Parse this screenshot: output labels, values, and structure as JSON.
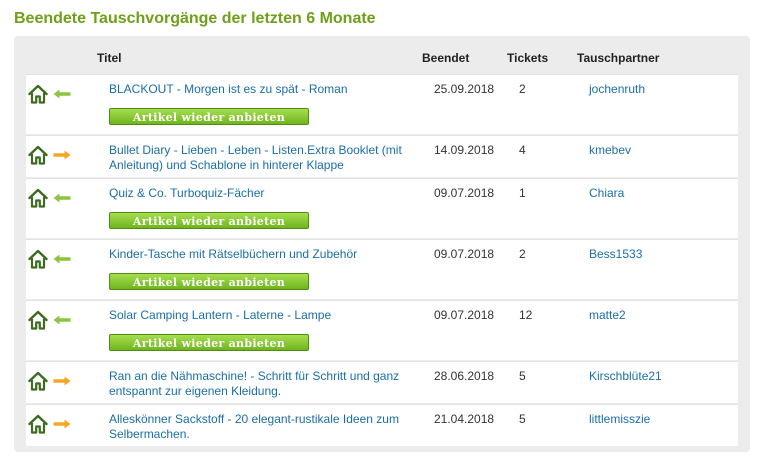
{
  "heading": "Beendete Tauschvorgänge der letzten 6 Monate",
  "columns": {
    "title": "Titel",
    "ended": "Beendet",
    "tickets": "Tickets",
    "partner": "Tauschpartner"
  },
  "reoffer_label": "Artikel wieder anbieten",
  "colors": {
    "heading": "#6ea018",
    "link": "#1a6ea6",
    "arrow_in": "#8cc63f",
    "arrow_out": "#f5a623",
    "button": "#7cbf2a"
  },
  "rows": [
    {
      "title": "BLACKOUT - Morgen ist es zu spät - Roman",
      "ended": "25.09.2018",
      "tickets": "2",
      "partner": "jochenruth",
      "direction": "received",
      "arrow_icon": "arrow-left-green-icon"
    },
    {
      "title": "Bullet Diary - Lieben - Leben - Listen.Extra Booklet (mit Anleitung) und Schablone in hinterer Klappe",
      "ended": "14.09.2018",
      "tickets": "4",
      "partner": "kmebev",
      "direction": "sent",
      "arrow_icon": "arrow-right-orange-icon"
    },
    {
      "title": "Quiz & Co. Turboquiz-Fächer",
      "ended": "09.07.2018",
      "tickets": "1",
      "partner": "Chiara",
      "direction": "received",
      "arrow_icon": "arrow-left-green-icon"
    },
    {
      "title": "Kinder-Tasche mit Rätselbüchern und Zubehör",
      "ended": "09.07.2018",
      "tickets": "2",
      "partner": "Bess1533",
      "direction": "received",
      "arrow_icon": "arrow-left-green-icon"
    },
    {
      "title": "Solar Camping Lantern - Laterne - Lampe",
      "ended": "09.07.2018",
      "tickets": "12",
      "partner": "matte2",
      "direction": "received",
      "arrow_icon": "arrow-left-green-icon"
    },
    {
      "title": "Ran an die Nähmaschine! - Schritt für Schritt und ganz entspannt zur eigenen Kleidung.",
      "ended": "28.06.2018",
      "tickets": "5",
      "partner": "Kirschblüte21",
      "direction": "sent",
      "arrow_icon": "arrow-right-orange-icon"
    },
    {
      "title": "Alleskönner Sackstoff - 20 elegant-rustikale Ideen zum Selbermachen.",
      "ended": "21.04.2018",
      "tickets": "5",
      "partner": "littlemisszie",
      "direction": "sent",
      "arrow_icon": "arrow-right-orange-icon"
    }
  ]
}
